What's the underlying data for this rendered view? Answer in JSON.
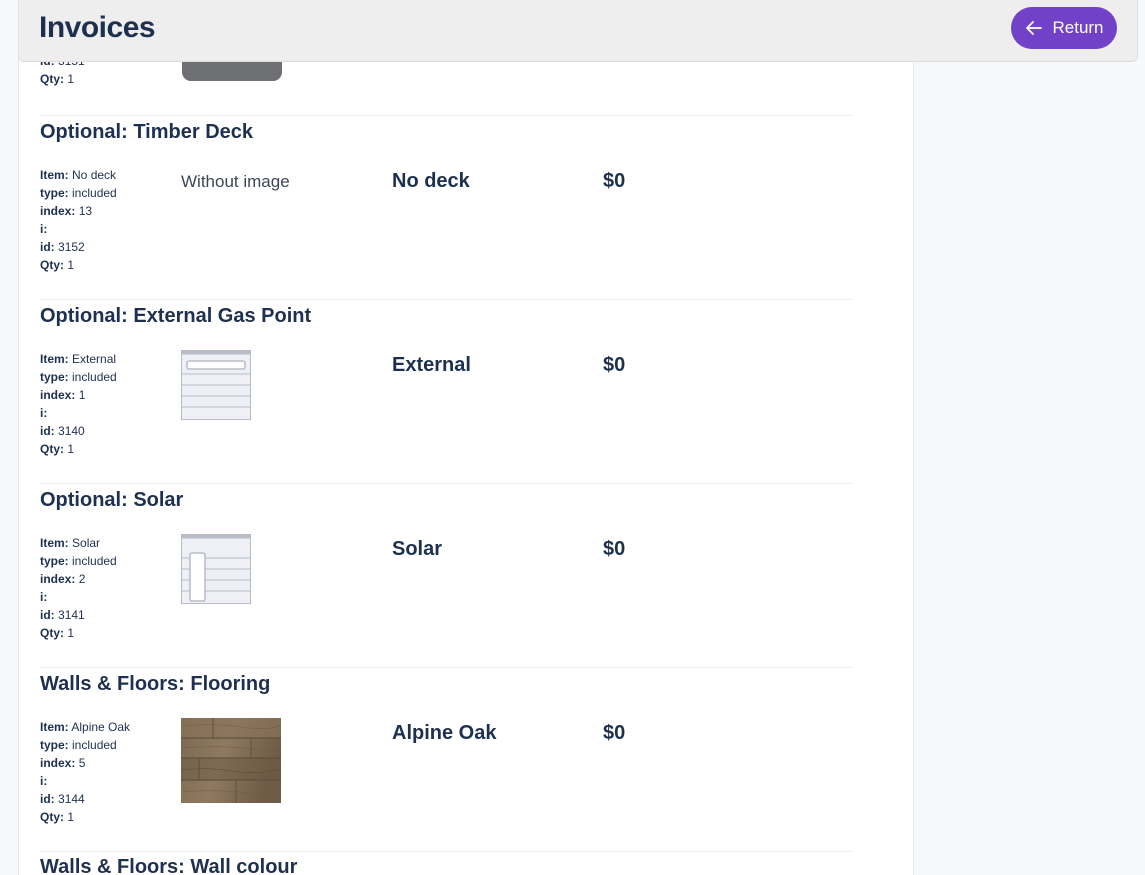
{
  "header": {
    "title": "Invoices",
    "return_label": "Return"
  },
  "labels": {
    "item": "Item:",
    "type": "type:",
    "index": "index:",
    "i": "i:",
    "id": "id:",
    "qty": "Qty:"
  },
  "previous_item": {
    "id": "3151",
    "qty": "1"
  },
  "sections": [
    {
      "title": "Optional: Timber Deck",
      "item": "No deck",
      "type": "included",
      "index": "13",
      "i": "",
      "id": "3152",
      "qty": "1",
      "image_text": "Without image",
      "name": "No deck",
      "price": "$0"
    },
    {
      "title": "Optional: External Gas Point",
      "item": "External",
      "type": "included",
      "index": "1",
      "i": "",
      "id": "3140",
      "qty": "1",
      "image_icon": "gas-point-icon",
      "name": "External",
      "price": "$0"
    },
    {
      "title": "Optional: Solar",
      "item": "Solar",
      "type": "included",
      "index": "2",
      "i": "",
      "id": "3141",
      "qty": "1",
      "image_icon": "solar-icon",
      "name": "Solar",
      "price": "$0"
    },
    {
      "title": "Walls & Floors: Flooring",
      "item": "Alpine Oak",
      "type": "included",
      "index": "5",
      "i": "",
      "id": "3144",
      "qty": "1",
      "image_icon": "wood-flooring-swatch",
      "name": "Alpine Oak",
      "price": "$0"
    },
    {
      "title": "Walls & Floors: Wall colour"
    }
  ],
  "colors": {
    "accent": "#7141c8",
    "text": "#1e3050",
    "header_bg": "#eeeeee"
  }
}
